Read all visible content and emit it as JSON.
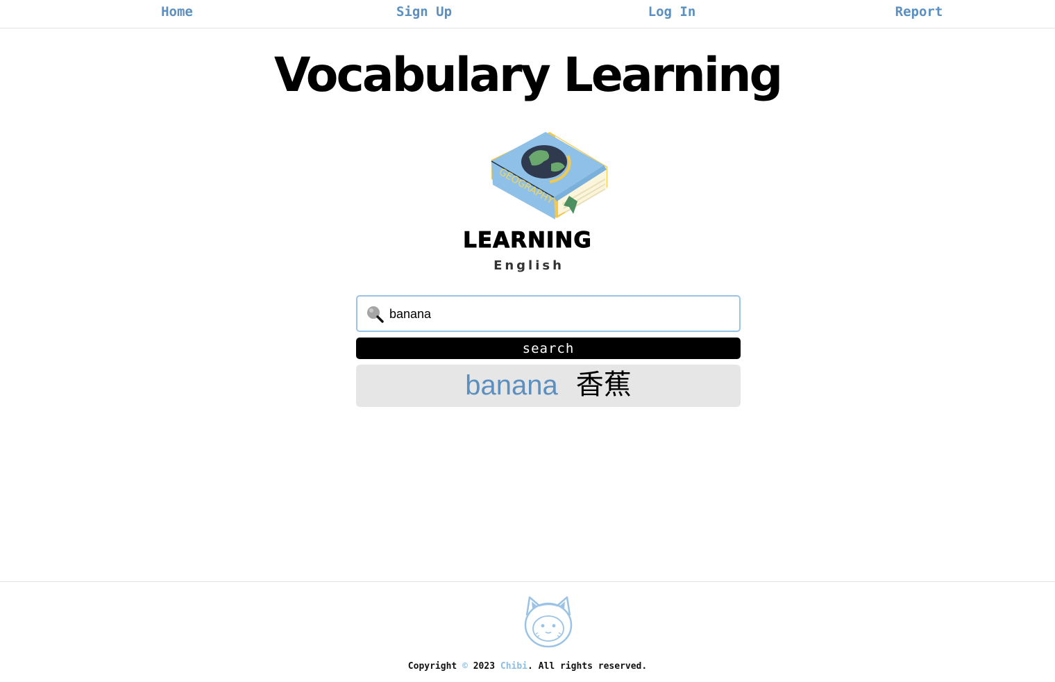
{
  "nav": {
    "home": "Home",
    "signup": "Sign Up",
    "login": "Log In",
    "report": "Report"
  },
  "header": {
    "title": "Vocabulary Learning"
  },
  "logo": {
    "book_text": "GEOGRAPHY",
    "word": "LEARNING",
    "language": "English"
  },
  "search": {
    "value": "banana",
    "button_label": "search"
  },
  "result": {
    "word": "banana",
    "translation": "香蕉"
  },
  "footer": {
    "copyright_prefix": "Copyright",
    "copyright_symbol": "©",
    "year": "2023",
    "brand": "Chibi",
    "suffix": ". All rights reserved."
  },
  "colors": {
    "accent": "#5a8fc0",
    "light_accent": "#9bc3e6"
  }
}
